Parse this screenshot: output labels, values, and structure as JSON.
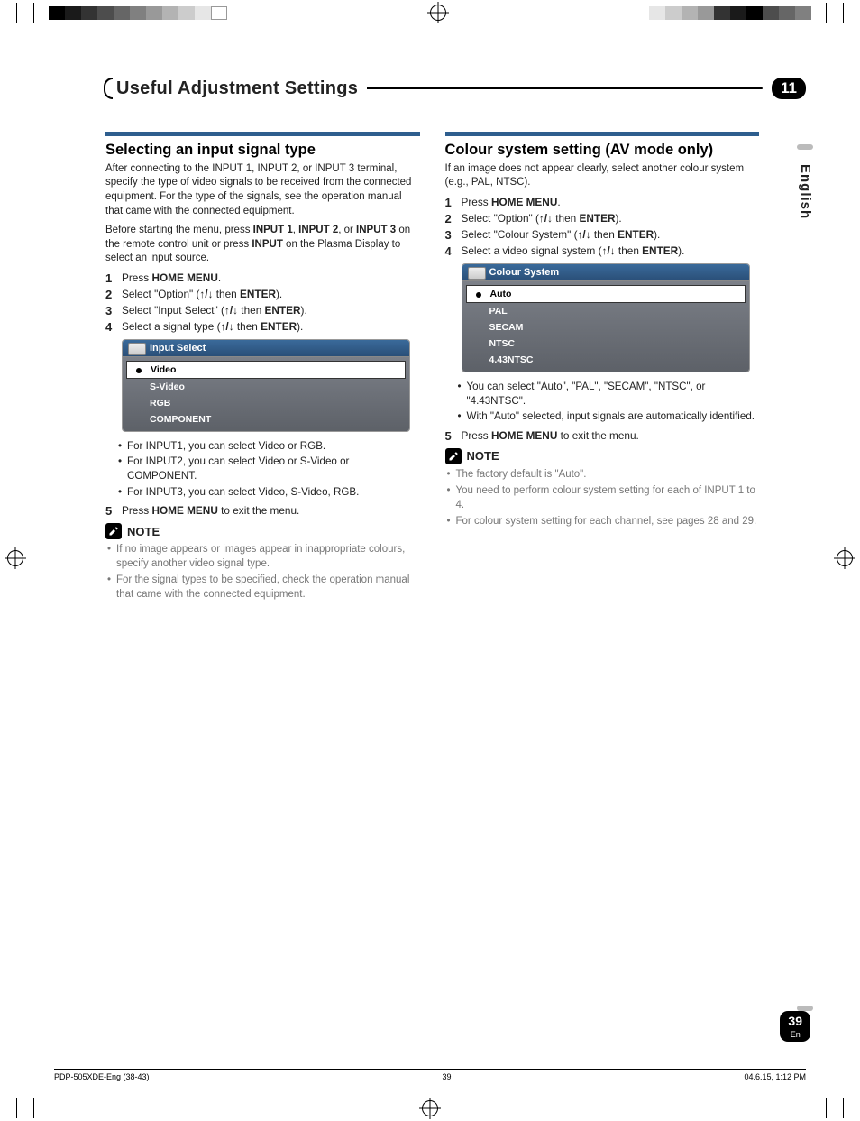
{
  "header": {
    "title": "Useful Adjustment Settings",
    "chapter": "11"
  },
  "language_tab": "English",
  "left": {
    "heading": "Selecting an input signal type",
    "intro": "After connecting to the INPUT 1, INPUT 2, or INPUT 3 terminal, specify the type of video signals to be received from the connected equipment. For the type of the signals, see the operation manual that came with the connected equipment.",
    "pre_step_a": "Before starting the menu, press ",
    "pre_step_b1": "INPUT 1",
    "pre_step_b_sep": ", ",
    "pre_step_b2": "INPUT 2",
    "pre_step_c": ", or ",
    "pre_step_b3": "INPUT 3",
    "pre_step_d": " on the remote control unit or press ",
    "pre_step_b4": "INPUT",
    "pre_step_e": " on the Plasma Display to select an input source.",
    "steps": {
      "s1_a": "Press ",
      "s1_b": "HOME MENU",
      "s1_c": ".",
      "s2_a": "Select \"Option\" (",
      "s2_b": " then ",
      "s2_c": "ENTER",
      "s2_d": ").",
      "s3_a": "Select \"Input Select\" (",
      "s3_b": " then ",
      "s3_c": "ENTER",
      "s3_d": ").",
      "s4_a": "Select a signal type (",
      "s4_b": " then ",
      "s4_c": "ENTER",
      "s4_d": ")."
    },
    "osd_title": "Input Select",
    "osd_items": [
      "Video",
      "S-Video",
      "RGB",
      "COMPONENT"
    ],
    "bullets": [
      "For INPUT1, you can select Video or RGB.",
      "For INPUT2, you can select Video or S-Video or COMPONENT.",
      "For INPUT3, you can select Video, S-Video, RGB."
    ],
    "step5_a": "Press ",
    "step5_b": "HOME MENU",
    "step5_c": " to exit the menu.",
    "note_label": "NOTE",
    "notes": [
      "If no image appears or images appear in inappropriate colours, specify another video signal type.",
      "For the signal types to be specified, check the operation manual that came with the connected equipment."
    ]
  },
  "right": {
    "heading": "Colour system setting (AV mode only)",
    "intro": "If an image does not appear clearly, select another colour system (e.g., PAL, NTSC).",
    "steps": {
      "s1_a": "Press ",
      "s1_b": "HOME MENU",
      "s1_c": ".",
      "s2_a": "Select \"Option\" (",
      "s2_b": " then ",
      "s2_c": "ENTER",
      "s2_d": ").",
      "s3_a": "Select \"Colour System\" (",
      "s3_b": " then ",
      "s3_c": "ENTER",
      "s3_d": ").",
      "s4_a": "Select a video signal system (",
      "s4_b": " then ",
      "s4_c": "ENTER",
      "s4_d": ")."
    },
    "osd_title": "Colour System",
    "osd_items": [
      "Auto",
      "PAL",
      "SECAM",
      "NTSC",
      "4.43NTSC"
    ],
    "bullets": [
      "You can select \"Auto\", \"PAL\", \"SECAM\", \"NTSC\", or \"4.43NTSC\".",
      "With \"Auto\" selected, input signals are automatically identified."
    ],
    "step5_a": "Press ",
    "step5_b": "HOME MENU",
    "step5_c": " to exit the menu.",
    "note_label": "NOTE",
    "notes": [
      "The factory default is \"Auto\".",
      "You need to perform colour system setting for each of INPUT 1 to 4.",
      "For colour system setting for each channel, see pages 28 and 29."
    ]
  },
  "page_number": "39",
  "page_number_sub": "En",
  "footer": {
    "left": "PDP-505XDE-Eng (38-43)",
    "center": "39",
    "right": "04.6.15, 1:12 PM"
  }
}
